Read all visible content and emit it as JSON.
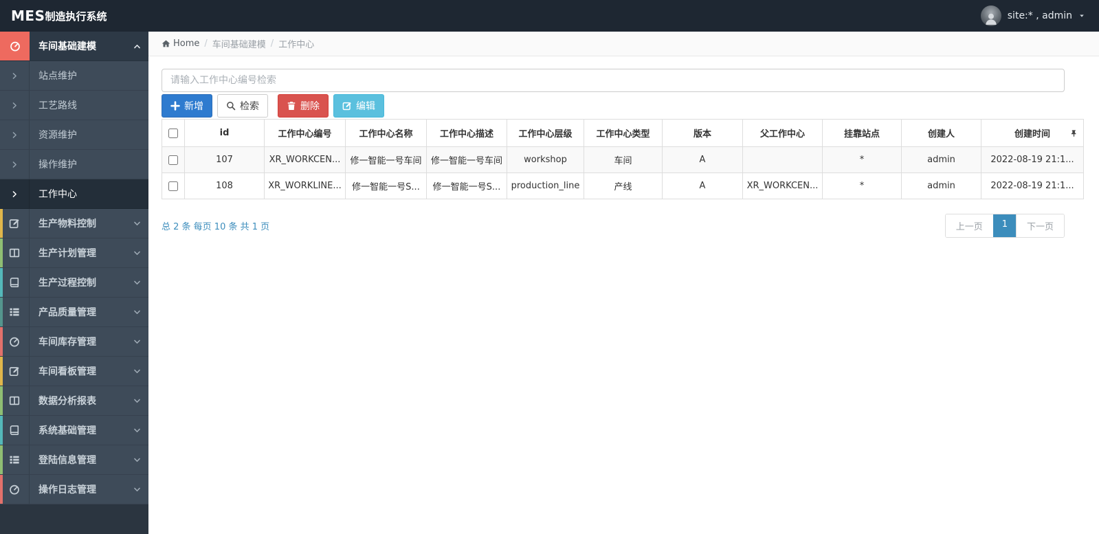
{
  "topbar": {
    "brand_bold": "MES",
    "brand_rest": "制造执行系统",
    "user_label": "site:* , admin"
  },
  "breadcrumb": {
    "home": "Home",
    "sep": "/",
    "level1": "车间基础建模",
    "level2": "工作中心"
  },
  "search": {
    "placeholder": "请输入工作中心编号检索"
  },
  "toolbar": {
    "add": {
      "label": "新增",
      "icon": "plus-icon",
      "color": "#2e7bcf"
    },
    "search": {
      "label": "检索",
      "icon": "magnifier-icon",
      "color": "#ffffff"
    },
    "delete": {
      "label": "删除",
      "icon": "trash-icon",
      "color": "#d9534f"
    },
    "edit": {
      "label": "编辑",
      "icon": "edit-icon",
      "color": "#5bc0de"
    }
  },
  "sidebar": {
    "active_group": {
      "label": "车间基础建模",
      "icon": "gauge-icon",
      "accent": "#ee6a5f",
      "expanded": true
    },
    "submenu": [
      {
        "label": "站点维护",
        "active": false
      },
      {
        "label": "工艺路线",
        "active": false
      },
      {
        "label": "资源维护",
        "active": false
      },
      {
        "label": "操作维护",
        "active": false
      },
      {
        "label": "工作中心",
        "active": true
      }
    ],
    "groups": [
      {
        "label": "生产物料控制",
        "icon": "pencil-square-icon",
        "accent": "#e0b64b"
      },
      {
        "label": "生产计划管理",
        "icon": "columns-icon",
        "accent": "#8fbe73"
      },
      {
        "label": "生产过程控制",
        "icon": "book-icon",
        "accent": "#54b8ba"
      },
      {
        "label": "产品质量管理",
        "icon": "th-list-icon",
        "accent": "#54958d"
      },
      {
        "label": "车间库存管理",
        "icon": "gauge-icon",
        "accent": "#e2716b"
      },
      {
        "label": "车间看板管理",
        "icon": "pencil-square-icon",
        "accent": "#e0b64b"
      },
      {
        "label": "数据分析报表",
        "icon": "columns-icon",
        "accent": "#8fbe73"
      },
      {
        "label": "系统基础管理",
        "icon": "book-icon",
        "accent": "#54b8ba"
      },
      {
        "label": "登陆信息管理",
        "icon": "th-list-icon",
        "accent": "#8fbe73"
      },
      {
        "label": "操作日志管理",
        "icon": "gauge-icon",
        "accent": "#e2716b"
      }
    ]
  },
  "table": {
    "headers": [
      "id",
      "工作中心编号",
      "工作中心名称",
      "工作中心描述",
      "工作中心层级",
      "工作中心类型",
      "版本",
      "父工作中心",
      "挂靠站点",
      "创建人",
      "创建时间"
    ],
    "rows": [
      {
        "cells": [
          "107",
          "XR_WORKCEN...",
          "修一智能一号车间",
          "修一智能一号车间",
          "workshop",
          "车间",
          "A",
          "",
          "*",
          "admin",
          "2022-08-19 21:1..."
        ]
      },
      {
        "cells": [
          "108",
          "XR_WORKLINE...",
          "修一智能一号S...",
          "修一智能一号S...",
          "production_line",
          "产线",
          "A",
          "XR_WORKCEN...",
          "*",
          "admin",
          "2022-08-19 21:1..."
        ]
      }
    ]
  },
  "pagination": {
    "summary": "总 2 条 每页 10 条 共 1 页",
    "prev": "上一页",
    "current": "1",
    "next": "下一页"
  },
  "colors": {
    "topbar_bg": "#1e2732",
    "sidebar_bg": "#3e4b59",
    "sidebar_active_bg": "#232e39",
    "active_group_bg": "#2d3946",
    "accent_red": "#ee6a5f",
    "link_blue": "#3c8dbc",
    "primary_blue": "#2e7bcf",
    "danger_red": "#d9534f",
    "info_cyan": "#5bc0de"
  }
}
